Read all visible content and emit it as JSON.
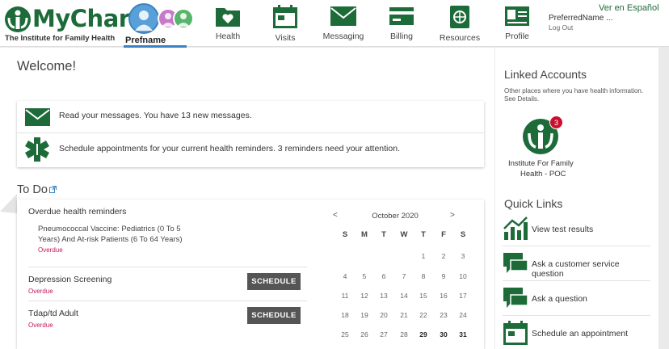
{
  "brand": {
    "name": "MyChart",
    "org": "The Institute for Family Health"
  },
  "proxy": {
    "active": "Prefname"
  },
  "nav": [
    {
      "label": "Health",
      "icon": "heart-folder-icon"
    },
    {
      "label": "Visits",
      "icon": "calendar-icon"
    },
    {
      "label": "Messaging",
      "icon": "envelope-icon"
    },
    {
      "label": "Billing",
      "icon": "credit-card-icon"
    },
    {
      "label": "Resources",
      "icon": "book-globe-icon"
    },
    {
      "label": "Profile",
      "icon": "id-card-icon"
    }
  ],
  "user": {
    "name": "PreferredName ...",
    "logout": "Log Out"
  },
  "language": "Ver en Español",
  "welcome": "Welcome!",
  "alerts": [
    {
      "text": "Read your messages. You have 13 new messages.",
      "icon": "envelope-icon"
    },
    {
      "text": "Schedule appointments for your current health reminders. 3 reminders need your attention.",
      "icon": "medical-star-icon"
    }
  ],
  "todo": {
    "title": "To Do",
    "group": "Overdue health reminders",
    "items": [
      {
        "line1": "Pneumococcal Vaccine: Pediatrics (0 To 5",
        "line2": "Years) And At-risk Patients (6 To 64 Years)",
        "status": "Overdue"
      },
      {
        "name": "Depression Screening",
        "status": "Overdue",
        "button": "SCHEDULE"
      },
      {
        "name": "Tdap/td Adult",
        "status": "Overdue",
        "button": "SCHEDULE"
      }
    ]
  },
  "calendar": {
    "month": "October 2020",
    "prev": "<",
    "next": ">",
    "dow": [
      "S",
      "M",
      "T",
      "W",
      "T",
      "F",
      "S"
    ],
    "weeks": [
      [
        "",
        "",
        "",
        "",
        "1",
        "2",
        "3"
      ],
      [
        "4",
        "5",
        "6",
        "7",
        "8",
        "9",
        "10"
      ],
      [
        "11",
        "12",
        "13",
        "14",
        "15",
        "16",
        "17"
      ],
      [
        "18",
        "19",
        "20",
        "21",
        "22",
        "23",
        "24"
      ],
      [
        "25",
        "26",
        "27",
        "28",
        "29",
        "30",
        "31"
      ]
    ],
    "bold_days": [
      "29",
      "30",
      "31"
    ]
  },
  "linked": {
    "title": "Linked Accounts",
    "sub": "Other places where you have health information.",
    "link": "See Details.",
    "org_line1": "Institute For Family",
    "org_line2": "Health - POC",
    "badge": "3"
  },
  "quicklinks": {
    "title": "Quick Links",
    "items": [
      {
        "label": "View test results",
        "icon": "chart-icon"
      },
      {
        "label": "Ask a customer service question",
        "icon": "chat-bubble-icon"
      },
      {
        "label": "Ask a question",
        "icon": "chat-bubble-icon"
      },
      {
        "label": "Schedule an appointment",
        "icon": "calendar-icon"
      }
    ]
  },
  "colors": {
    "brand": "#1e6b3a",
    "overdue": "#c2185b",
    "badge": "#c8102e",
    "button": "#555555"
  }
}
